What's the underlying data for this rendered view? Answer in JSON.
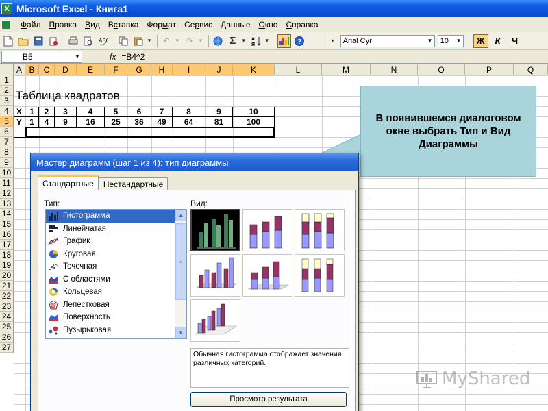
{
  "window": {
    "title": "Microsoft Excel - Книга1"
  },
  "menu": [
    {
      "label": "Файл",
      "u": "Ф",
      "rest": "айл"
    },
    {
      "label": "Правка",
      "u": "П",
      "rest": "равка"
    },
    {
      "label": "Вид",
      "u": "В",
      "rest": "ид"
    },
    {
      "label": "Вставка",
      "u": "с",
      "pre": "В",
      "rest": "тавка"
    },
    {
      "label": "Формат",
      "u": "м",
      "pre": "Фор",
      "rest": "ат"
    },
    {
      "label": "Сервис",
      "u": "р",
      "pre": "Се",
      "rest": "вис"
    },
    {
      "label": "Данные",
      "u": "Д",
      "rest": "анные"
    },
    {
      "label": "Окно",
      "u": "О",
      "rest": "кно"
    },
    {
      "label": "Справка",
      "u": "С",
      "rest": "правка"
    }
  ],
  "toolbar": {
    "font_name": "Arial Cyr",
    "font_size": "10",
    "bold_label": "Ж",
    "italic_label": "К",
    "underline_label": "Ч",
    "sum_label": "Σ"
  },
  "formula_bar": {
    "cell_ref": "B5",
    "fx": "fx",
    "formula": "=B4^2"
  },
  "columns": [
    "A",
    "B",
    "C",
    "D",
    "E",
    "F",
    "G",
    "H",
    "I",
    "J",
    "K",
    "L",
    "M",
    "N",
    "O",
    "P",
    "Q"
  ],
  "rows": [
    "1",
    "2",
    "3",
    "4",
    "5",
    "6",
    "7",
    "8",
    "9",
    "10",
    "11",
    "12",
    "13",
    "14",
    "15",
    "16",
    "17",
    "18",
    "19",
    "20",
    "21",
    "22",
    "23",
    "24",
    "25",
    "26",
    "27"
  ],
  "sheet": {
    "title": "Таблица квадратов",
    "row_x": [
      "X",
      "1",
      "2",
      "3",
      "4",
      "5",
      "6",
      "7",
      "8",
      "9",
      "10"
    ],
    "row_y": [
      "Y",
      "1",
      "4",
      "9",
      "16",
      "25",
      "36",
      "49",
      "64",
      "81",
      "100"
    ]
  },
  "callout": {
    "text": "В появившемся диалоговом окне выбрать Тип  и Вид Диаграммы"
  },
  "dialog": {
    "title": "Мастер диаграмм (шаг 1 из 4): тип диаграммы",
    "tabs": [
      "Стандартные",
      "Нестандартные"
    ],
    "type_label": "Тип:",
    "view_label": "Вид:",
    "chart_types": [
      {
        "label": "Гистограмма",
        "icon": "histogram-icon"
      },
      {
        "label": "Линейчатая",
        "icon": "bar-chart-icon"
      },
      {
        "label": "График",
        "icon": "line-chart-icon"
      },
      {
        "label": "Круговая",
        "icon": "pie-chart-icon"
      },
      {
        "label": "Точечная",
        "icon": "scatter-chart-icon"
      },
      {
        "label": "С областями",
        "icon": "area-chart-icon"
      },
      {
        "label": "Кольцевая",
        "icon": "doughnut-chart-icon"
      },
      {
        "label": "Лепестковая",
        "icon": "radar-chart-icon"
      },
      {
        "label": "Поверхность",
        "icon": "surface-chart-icon"
      },
      {
        "label": "Пузырьковая",
        "icon": "bubble-chart-icon"
      }
    ],
    "description": "Обычная гистограмма отображает значения различных категорий.",
    "preview_button": "Просмотр результата"
  },
  "watermark": {
    "text": "MyShared"
  },
  "colors": {
    "callout_bg": "#a9d4dc",
    "selection": "#316ac5",
    "header_highlight": "#ffc873",
    "bar_purple": "#9999ff",
    "bar_maroon": "#993366",
    "bar_cream": "#ffffcc",
    "bar_green": "#339966"
  }
}
